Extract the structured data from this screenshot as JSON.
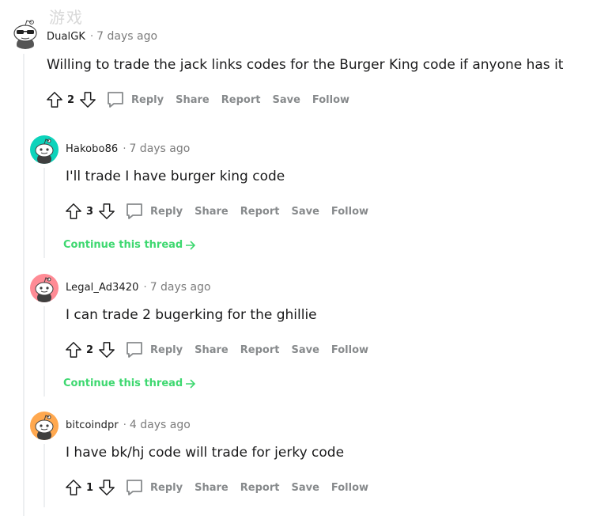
{
  "watermark": "游戏",
  "comments": [
    {
      "author": "DualGK",
      "time": "7 days ago",
      "text": "Willing to trade the jack links codes for the Burger King code if anyone has it",
      "score": "2",
      "avatar_color": "#ffffff",
      "avatar_icon": "snoo-sunglasses-avatar"
    },
    {
      "author": "Hakobo86",
      "time": "7 days ago",
      "text": "I'll trade I have burger king code",
      "score": "3",
      "avatar_color": "#0dd3bb",
      "avatar_icon": "snoo-avatar",
      "continue": "Continue this thread"
    },
    {
      "author": "Legal_Ad3420",
      "time": "7 days ago",
      "text": "I can trade 2 bugerking for the ghillie",
      "score": "2",
      "avatar_color": "#ff8b95",
      "avatar_icon": "snoo-avatar",
      "continue": "Continue this thread"
    },
    {
      "author": "bitcoindpr",
      "time": "4 days ago",
      "text": "I have bk/hj code will trade for jerky code",
      "score": "1",
      "avatar_color": "#ffa84f",
      "avatar_icon": "snoo-avatar"
    }
  ],
  "actions": {
    "reply": "Reply",
    "share": "Share",
    "report": "Report",
    "save": "Save",
    "follow": "Follow"
  },
  "colors": {
    "action_gray": "#878a8c",
    "continue_green": "#3ed870",
    "thread_line": "#edeff1"
  }
}
